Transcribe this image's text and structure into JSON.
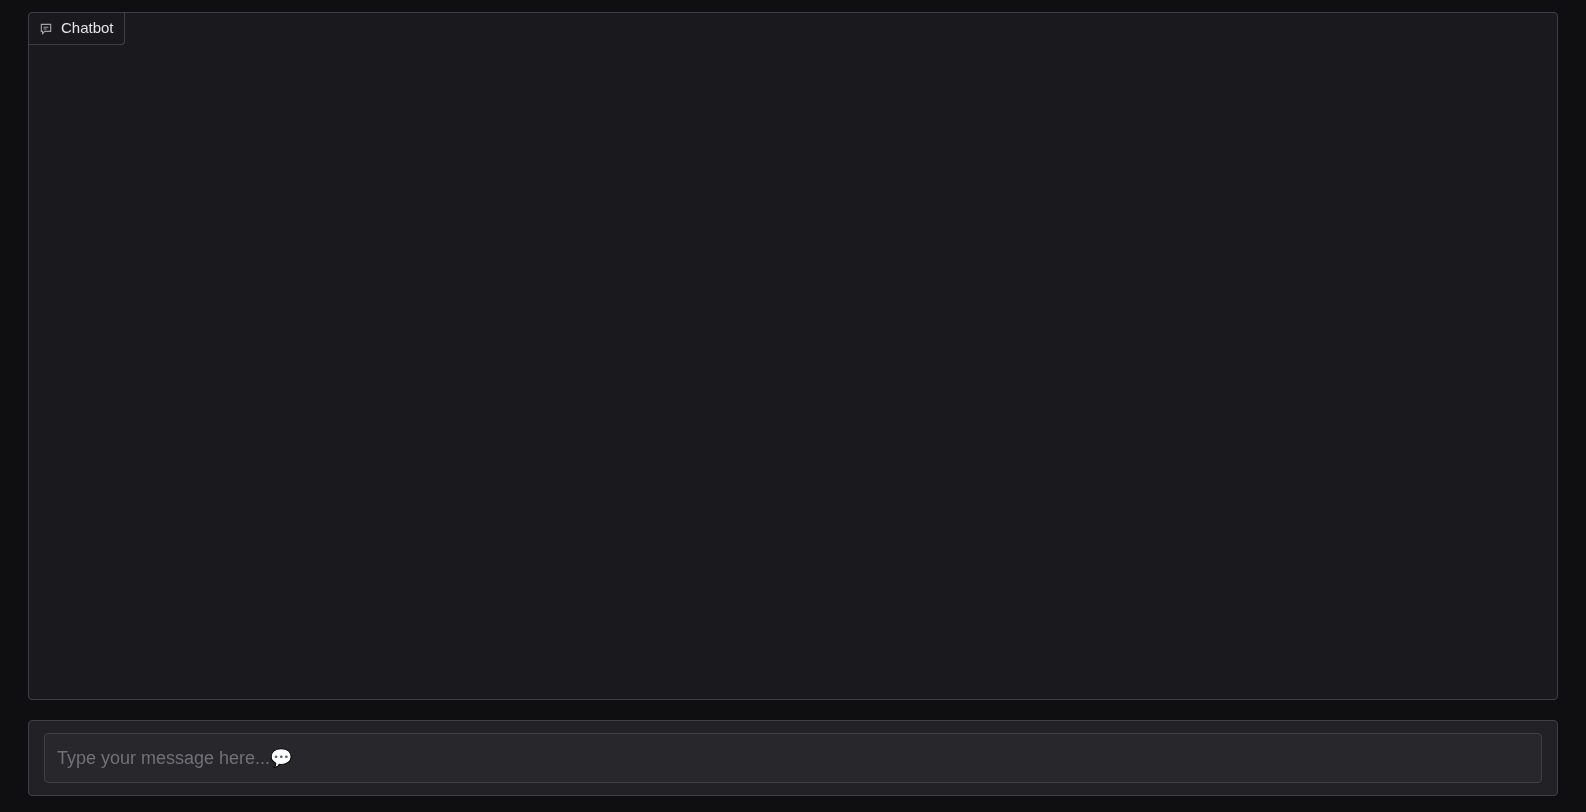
{
  "chatbot": {
    "label": "Chatbot"
  },
  "message_input": {
    "placeholder": "Type your message here...💬"
  }
}
